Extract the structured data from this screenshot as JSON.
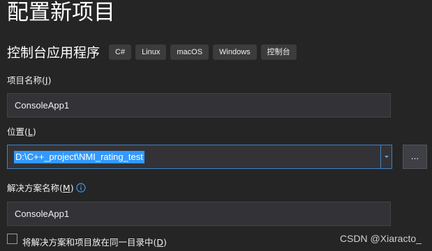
{
  "page": {
    "title": "配置新项目"
  },
  "template": {
    "name": "控制台应用程序",
    "tags": [
      "C#",
      "Linux",
      "macOS",
      "Windows",
      "控制台"
    ]
  },
  "fields": {
    "project_name": {
      "label_text": "项目名称(",
      "label_access_key": "J",
      "label_suffix": ")",
      "value": "ConsoleApp1"
    },
    "location": {
      "label_text": "位置(",
      "label_access_key": "L",
      "label_suffix": ")",
      "value": "D:\\C++_project\\NMI_rating_test",
      "browse_label": "..."
    },
    "solution_name": {
      "label_text": "解决方案名称(",
      "label_access_key": "M",
      "label_suffix": ")",
      "value": "ConsoleApp1"
    }
  },
  "options": {
    "same_directory": {
      "label_text": "将解决方案和项目放在同一目录中(",
      "label_access_key": "D",
      "label_suffix": ")",
      "checked": false
    }
  },
  "watermark": "CSDN @Xiaracto_",
  "colors": {
    "background": "#252526",
    "input_background": "#333337",
    "focus_border": "#3f83c4",
    "selection": "#3399ff"
  }
}
